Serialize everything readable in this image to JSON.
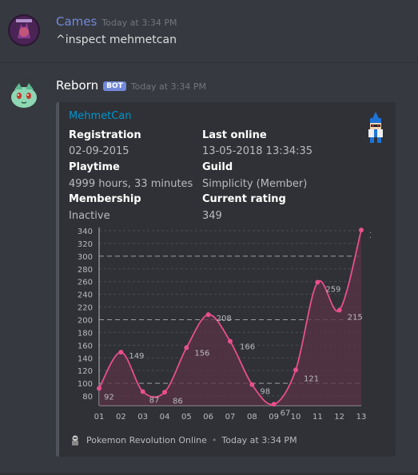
{
  "messages": [
    {
      "author": "Cames",
      "author_color": "#7289da",
      "timestamp": "Today at 3:34 PM",
      "content": "^inspect mehmetcan"
    },
    {
      "author": "Reborn",
      "author_color": "#ffffff",
      "badge": "BOT",
      "timestamp": "Today at 3:34 PM"
    }
  ],
  "embed": {
    "author": "MehmetCan",
    "fields": [
      {
        "name": "Registration",
        "value": "02-09-2015"
      },
      {
        "name": "Last online",
        "value": "13-05-2018 13:34:35"
      },
      {
        "name": "Playtime",
        "value": "4999 hours, 33 minutes"
      },
      {
        "name": "Guild",
        "value": "Simplicity (Member)"
      },
      {
        "name": "Membership",
        "value": "Inactive"
      },
      {
        "name": "Current rating",
        "value": "349"
      }
    ],
    "footer_text": "Pokemon Revolution Online",
    "footer_separator": "•",
    "footer_timestamp": "Today at 3:34 PM"
  },
  "chart_data": {
    "type": "area",
    "categories": [
      "01",
      "02",
      "03",
      "04",
      "05",
      "06",
      "07",
      "08",
      "09",
      "10",
      "11",
      "12",
      "13"
    ],
    "values": [
      92,
      149,
      87,
      86,
      156,
      208,
      166,
      98,
      67,
      121,
      259,
      215,
      341
    ],
    "yticks": [
      80,
      100,
      120,
      140,
      160,
      180,
      200,
      220,
      240,
      260,
      280,
      300,
      320,
      340
    ],
    "ylim": [
      65,
      345
    ],
    "line_color": "#e94f8c",
    "fill_color": "#5a3345",
    "highlight_lines": [
      100,
      200,
      300
    ],
    "grid": true
  }
}
